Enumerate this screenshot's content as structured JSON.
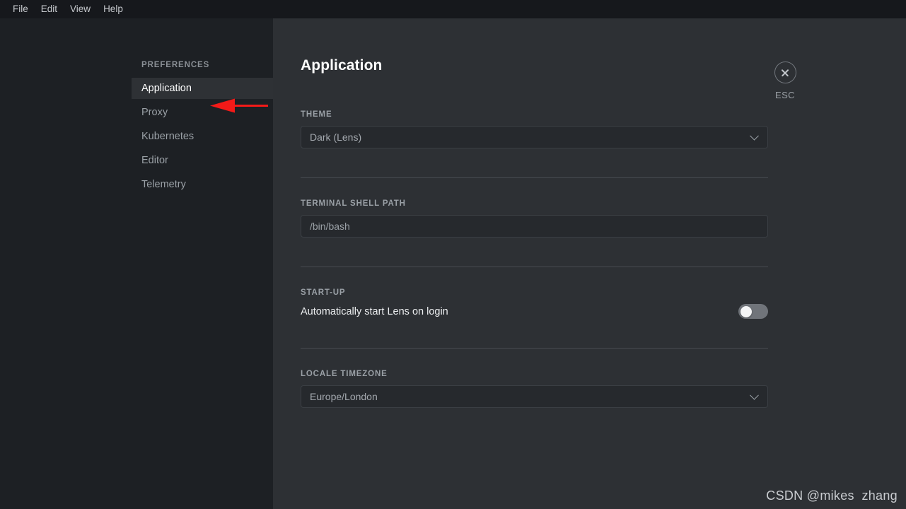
{
  "window": {
    "menubar": [
      {
        "label": "File"
      },
      {
        "label": "Edit"
      },
      {
        "label": "View"
      },
      {
        "label": "Help"
      }
    ]
  },
  "sidebar": {
    "header": "PREFERENCES",
    "items": [
      {
        "label": "Application",
        "active": true
      },
      {
        "label": "Proxy",
        "active": false
      },
      {
        "label": "Kubernetes",
        "active": false
      },
      {
        "label": "Editor",
        "active": false
      },
      {
        "label": "Telemetry",
        "active": false
      }
    ]
  },
  "annotation": {
    "type": "arrow",
    "color": "#f41a18",
    "points_to": "Application"
  },
  "main": {
    "title": "Application",
    "close": {
      "icon": "close-icon",
      "label": "ESC"
    },
    "sections": {
      "theme": {
        "label": "THEME",
        "value": "Dark (Lens)",
        "chevron": "chevron-down-icon"
      },
      "terminal_shell_path": {
        "label": "TERMINAL SHELL PATH",
        "value": "",
        "placeholder": "/bin/bash"
      },
      "startup": {
        "label": "START-UP",
        "option_label": "Automatically start Lens on login",
        "toggle_state": "off"
      },
      "locale_timezone": {
        "label": "LOCALE TIMEZONE",
        "value": "Europe/London",
        "chevron": "chevron-down-icon"
      }
    }
  },
  "watermark": {
    "text": "CSDN @mikes  zhang"
  },
  "colors": {
    "sidebar_bg": "#1d2024",
    "content_bg": "#2d3034",
    "menubar_bg": "#16181c",
    "active_item_bg": "#2e3135",
    "annotation_red": "#f41a18",
    "input_bg": "#26292d"
  }
}
